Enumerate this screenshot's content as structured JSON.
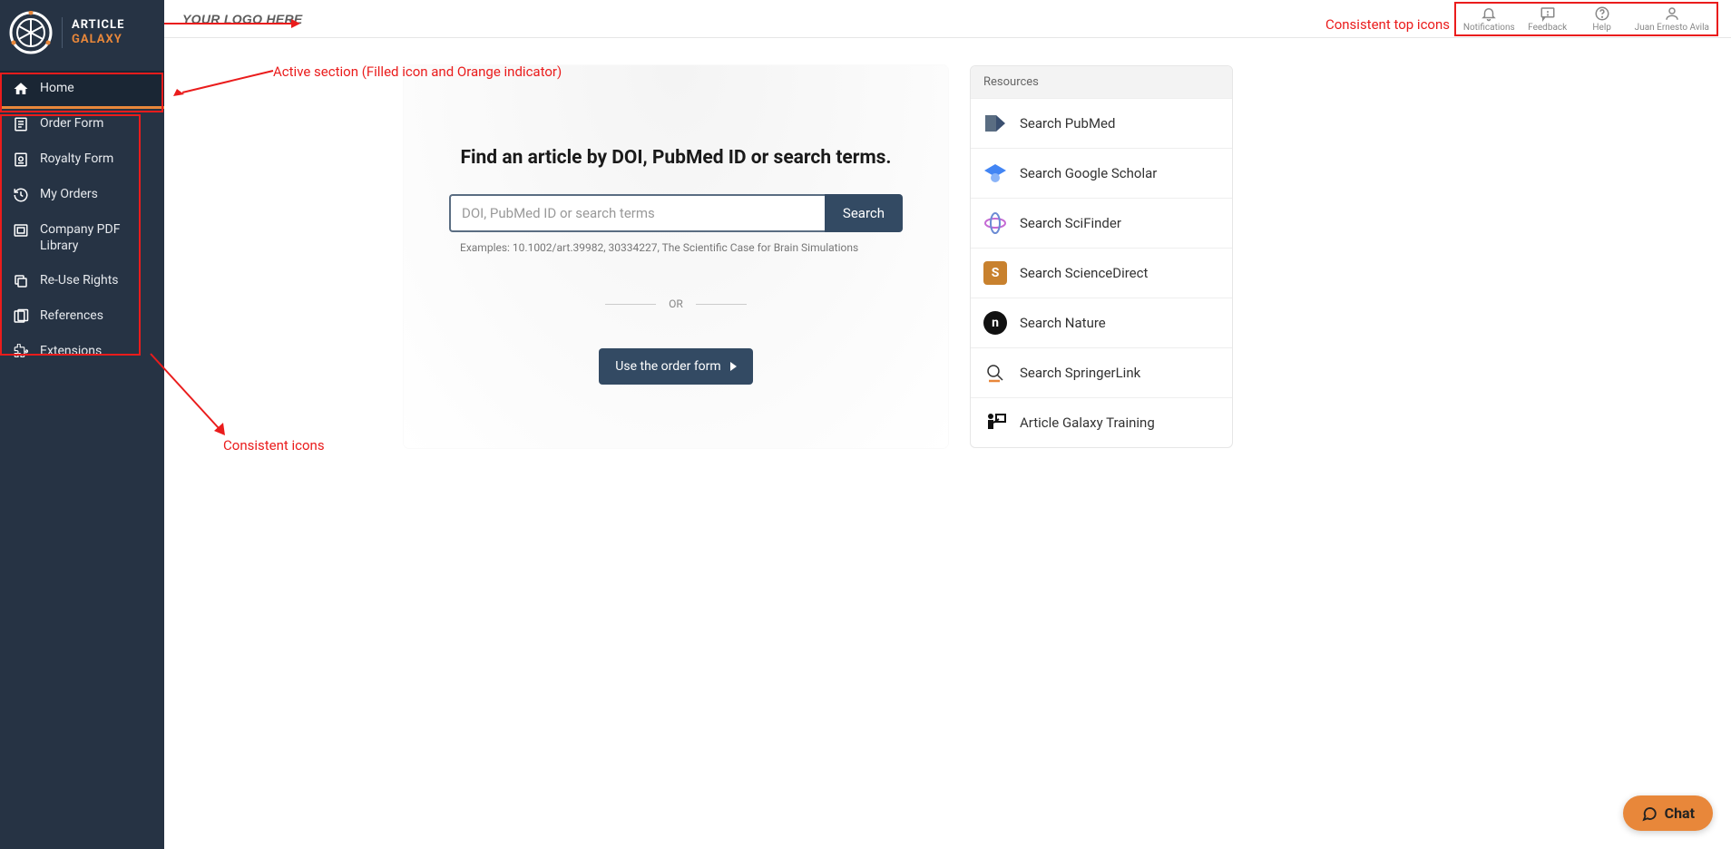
{
  "brand": {
    "line1": "ARTICLE",
    "line2": "GALAXY"
  },
  "sidebar": {
    "items": [
      {
        "label": "Home",
        "icon": "home",
        "active": true
      },
      {
        "label": "Order Form",
        "icon": "order-form"
      },
      {
        "label": "Royalty Form",
        "icon": "royalty-form"
      },
      {
        "label": "My Orders",
        "icon": "history"
      },
      {
        "label": "Company PDF Library",
        "icon": "library"
      },
      {
        "label": "Re-Use Rights",
        "icon": "copy"
      },
      {
        "label": "References",
        "icon": "references"
      },
      {
        "label": "Extensions",
        "icon": "extension"
      }
    ]
  },
  "topbar": {
    "logo_text": "YOUR LOGO HERE",
    "icons": [
      {
        "label": "Notifications",
        "icon": "bell"
      },
      {
        "label": "Feedback",
        "icon": "feedback"
      },
      {
        "label": "Help",
        "icon": "help"
      },
      {
        "label": "Juan Ernesto Avila",
        "icon": "user"
      }
    ]
  },
  "search": {
    "heading": "Find an article by DOI, PubMed ID or search terms.",
    "placeholder": "DOI, PubMed ID or search terms",
    "button": "Search",
    "examples": "Examples: 10.1002/art.39982, 30334227, The Scientific Case for Brain Simulations",
    "or": "OR",
    "order_form_btn": "Use the order form"
  },
  "resources": {
    "header": "Resources",
    "items": [
      {
        "label": "Search PubMed",
        "icon": "pubmed"
      },
      {
        "label": "Search Google Scholar",
        "icon": "scholar"
      },
      {
        "label": "Search SciFinder",
        "icon": "scifinder"
      },
      {
        "label": "Search ScienceDirect",
        "icon": "sd"
      },
      {
        "label": "Search Nature",
        "icon": "nature"
      },
      {
        "label": "Search SpringerLink",
        "icon": "springer"
      },
      {
        "label": "Article Galaxy Training",
        "icon": "training"
      }
    ]
  },
  "chat": {
    "label": "Chat"
  },
  "annotations": {
    "top_icons": "Consistent top icons",
    "active_section": "Active section (Filled icon and Orange indicator)",
    "consistent_icons": "Consistent icons"
  }
}
